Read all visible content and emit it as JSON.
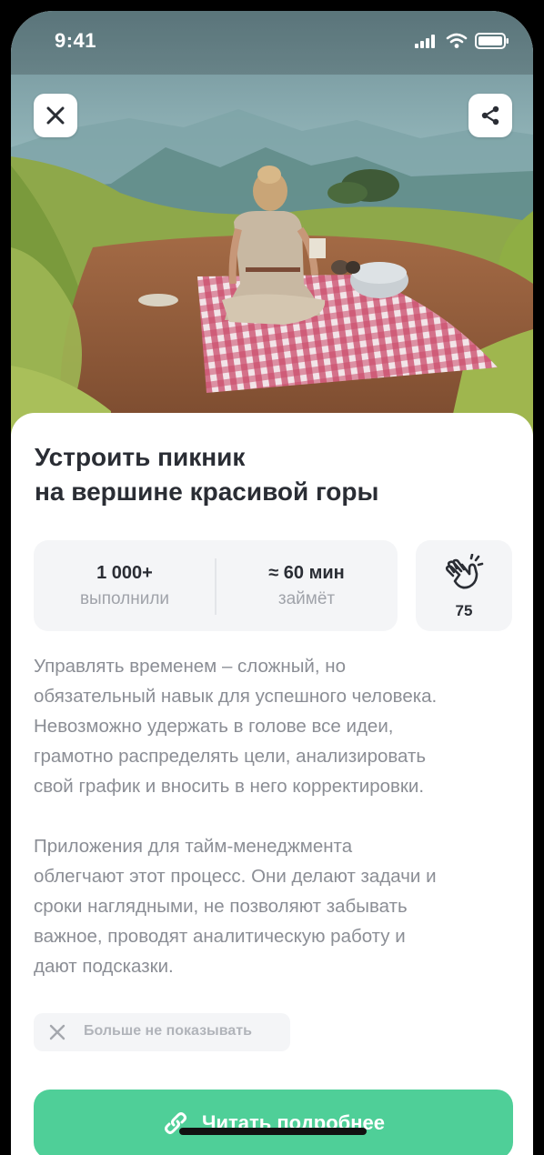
{
  "status_bar": {
    "time": "9:41",
    "icons": [
      "signal-icon",
      "wifi-icon",
      "battery-icon"
    ]
  },
  "hero": {
    "image": "woman-on-picnic-blanket-mountain-view",
    "close_icon": "close-icon",
    "share_icon": "share-icon"
  },
  "card": {
    "title_lines": [
      "Устроить пикник",
      "на вершине красивой горы"
    ],
    "stats": [
      {
        "value": "1 000+",
        "label": "выполнили"
      },
      {
        "value": "≈ 60 мин",
        "label": "займёт"
      }
    ],
    "claps": {
      "icon": "clapping-hands-icon",
      "count": "75"
    },
    "description": [
      [
        "Управлять временем – сложный, но",
        "обязательный навык для успешного человека.",
        "Невозможно удержать в голове все идеи,",
        "грамотно распределять цели, анализировать",
        "свой график и вносить в него корректировки."
      ],
      [
        "Приложения для тайм-менеджмента",
        "облегчают этот процесс. Они делают задачи и",
        "сроки наглядными, не позволяют забывать",
        "важное, проводят аналитическую работу и",
        "дают подсказки."
      ]
    ],
    "dont_show_label": "Больше не показывать",
    "read_more_label": "Читать подробнее"
  },
  "colors": {
    "accent": "#4fcf98",
    "title": "#2a2d34",
    "muted": "#8b8e95",
    "chip_bg": "#f4f5f7"
  }
}
